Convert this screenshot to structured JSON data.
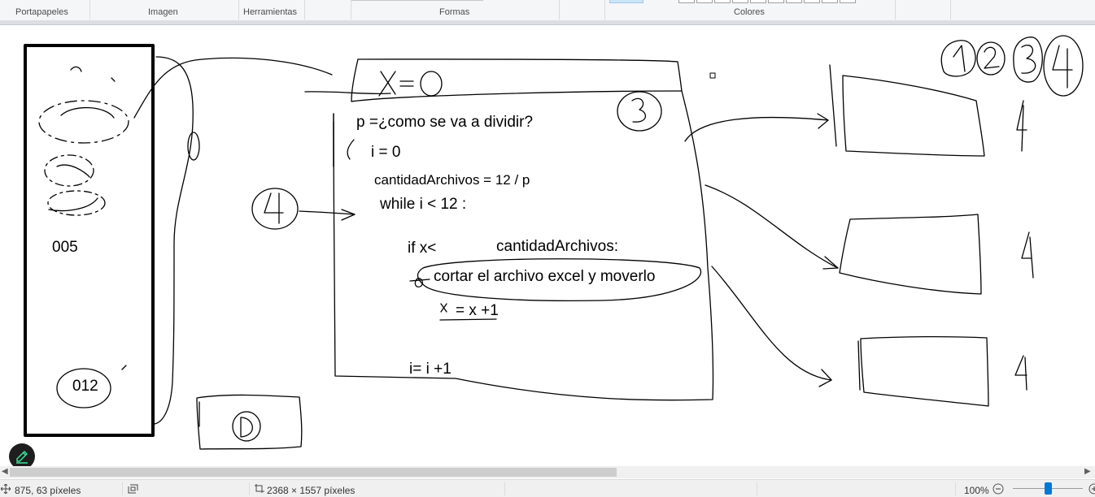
{
  "ribbon": {
    "groups": [
      "Portapapeles",
      "Imagen",
      "Herramientas",
      "Formas",
      "Colores"
    ]
  },
  "canvas_text": {
    "n005": "005",
    "n012": "012",
    "p_line": "p =¿como se va a dividir?",
    "i0": "i = 0",
    "cantidad": "cantidadArchivos = 12 / p",
    "while_line": "while i < 12 :",
    "if_x": "if  x<",
    "if_cond": "cantidadArchivos:",
    "cortar": "cortar el archivo excel y moverlo",
    "x_inc": "= x +1",
    "i_inc": "i= i +1"
  },
  "handwriting": [
    "X = 0",
    "3",
    "4",
    "1",
    "2",
    "3",
    "4",
    "4",
    "4",
    "4",
    "D"
  ],
  "statusbar": {
    "cursor_position": "875, 63 píxeles",
    "image_size": "2368 × 1557 píxeles",
    "zoom": "100%"
  },
  "icons": [
    "cursor-position-icon",
    "selection-size-icon",
    "image-size-icon",
    "zoom-out-icon",
    "zoom-in-icon",
    "edit-pencil-icon",
    "scroll-left-icon",
    "scroll-right-icon"
  ],
  "colors": {
    "accent": "#0078d7",
    "fab": "#1e1e1e",
    "fab_icon": "#3ee19b"
  }
}
